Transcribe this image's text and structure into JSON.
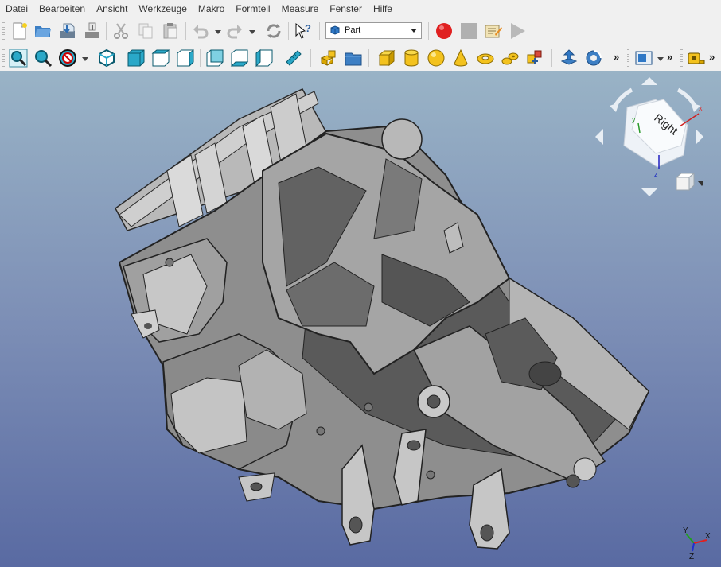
{
  "menu": [
    "Datei",
    "Bearbeiten",
    "Ansicht",
    "Werkzeuge",
    "Makro",
    "Formteil",
    "Measure",
    "Fenster",
    "Hilfe"
  ],
  "workbench": {
    "selected": "Part"
  },
  "toolbar1": [
    "new-file",
    "open-file",
    "save-file",
    "save-as",
    "cut",
    "copy",
    "paste",
    "undo",
    "redo",
    "refresh",
    "whats-this",
    "record-macro",
    "stop-macro",
    "edit-macro",
    "execute-macro"
  ],
  "toolbar2": [
    "fit-all",
    "fit-selection",
    "draw-style",
    "isometric",
    "front",
    "top",
    "right",
    "rear",
    "bottom",
    "left",
    "measure-distance",
    "part-primitives",
    "create-group",
    "box",
    "cylinder",
    "sphere",
    "cone",
    "torus",
    "tube",
    "part-tools",
    "import",
    "revolve",
    "view-menu",
    "measure-tool"
  ],
  "toolbar_overflow": "»",
  "navcube": {
    "face_label": "Right",
    "axes": [
      "x",
      "y",
      "z"
    ]
  },
  "axis_cross": {
    "labels": [
      "Y",
      "X",
      "Z"
    ]
  },
  "colors": {
    "viewport_top": "#99b3c6",
    "viewport_bottom": "#596aa2",
    "part_face": "#a8a8a8",
    "record": "#e02020",
    "accent": "#2aa8c8"
  }
}
